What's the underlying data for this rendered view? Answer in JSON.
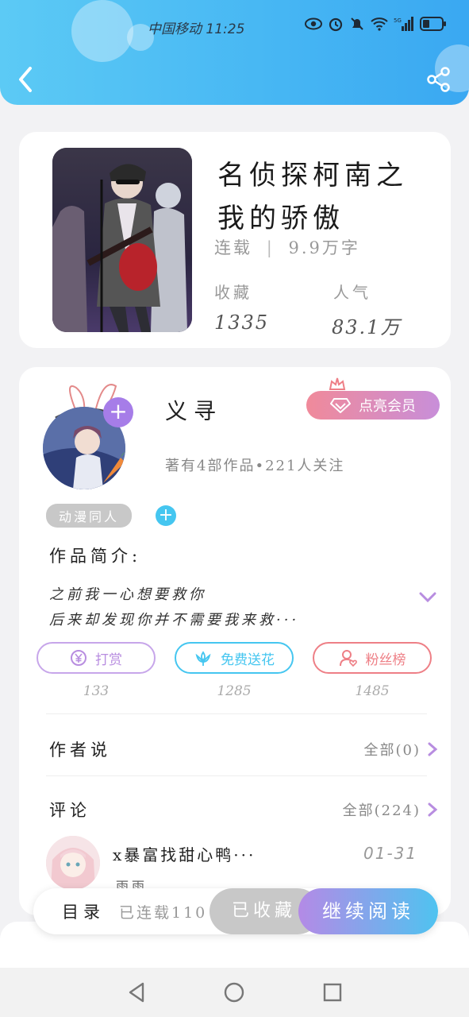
{
  "status_bar": {
    "carrier": "中国移动",
    "time": "11:25",
    "icons": [
      "eye-icon",
      "alarm-icon",
      "mute-icon",
      "wifi-icon",
      "signal-5g-icon",
      "battery-icon"
    ]
  },
  "header": {
    "back_icon": "chevron-left-icon",
    "share_icon": "share-icon"
  },
  "book": {
    "title_line1": "名侦探柯南之",
    "title_line2": "我的骄傲",
    "status": "连载",
    "separator": "|",
    "word_count": "9.9万字",
    "favorites_label": "收藏",
    "favorites_value": "1335",
    "popularity_label": "人气",
    "popularity_value": "83.1万"
  },
  "author": {
    "name": "义寻",
    "description": "著有4部作品•221人关注",
    "vip_label": "点亮会员",
    "tag": "动漫同人",
    "follow_symbol": "+",
    "add_tag_symbol": "+"
  },
  "intro": {
    "title": "作品简介:",
    "line1": "之前我一心想要救你",
    "line2": "后来却发现你并不需要我来救···"
  },
  "actions": [
    {
      "label": "打赏",
      "count": "133",
      "color": "#b88de0",
      "icon": "yen-icon"
    },
    {
      "label": "免费送花",
      "count": "1285",
      "color": "#45c6f0",
      "icon": "flower-icon"
    },
    {
      "label": "粉丝榜",
      "count": "1485",
      "color": "#ee7f86",
      "icon": "fan-icon"
    }
  ],
  "author_says": {
    "title": "作者说",
    "link": "全部(0)"
  },
  "comments": {
    "title": "评论",
    "link": "全部(224)",
    "first": {
      "text": "x暴富找甜心鸭···",
      "date": "01-31",
      "user": "雨雨"
    }
  },
  "bottom_bar": {
    "toc_label": "目录",
    "toc_status": "已连载110",
    "collected_label": "已收藏",
    "read_label": "继续阅读"
  },
  "colors": {
    "header_gradient_start": "#5ccaf5",
    "header_gradient_end": "#3aa8f2",
    "accent_purple": "#b88de0",
    "accent_blue": "#45c6f0",
    "accent_pink": "#ee7f86"
  }
}
